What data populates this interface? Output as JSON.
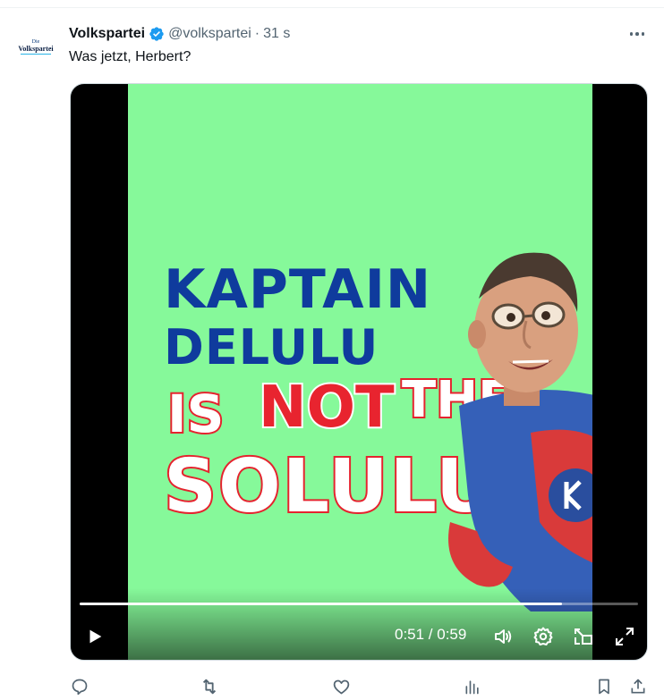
{
  "post": {
    "author": {
      "display_name": "Volkspartei",
      "handle": "@volkspartei",
      "separator": "·",
      "time": "31 s",
      "avatar_small_text": "Die",
      "avatar_big_text": "Volkspartei",
      "verified_color": "#1d9bf0"
    },
    "text": "Was jetzt, Herbert?",
    "more_icon": "more-horizontal-icon"
  },
  "video": {
    "headline_line1": "KAPTAIN",
    "headline_line2": "DELULU",
    "headline_is": "IS",
    "headline_not": "NOT",
    "headline_the": "THE",
    "headline_solulu": "SOLULU!",
    "background_color": "#86f99a",
    "current_time": "0:51",
    "duration": "0:59",
    "time_display": "0:51 / 0:59",
    "progress_fraction": 0.864
  },
  "controls": {
    "play_icon": "play-icon",
    "volume_icon": "volume-icon",
    "settings_icon": "gear-icon",
    "pip_icon": "picture-in-picture-icon",
    "fullscreen_icon": "fullscreen-icon"
  },
  "actions": [
    "reply-icon",
    "retweet-icon",
    "like-icon",
    "views-icon",
    "bookmark-icon",
    "share-icon"
  ],
  "colors": {
    "text_primary": "#0f1419",
    "text_secondary": "#536471",
    "headline_blue": "#0f3b9d",
    "headline_red": "#e8242f"
  }
}
